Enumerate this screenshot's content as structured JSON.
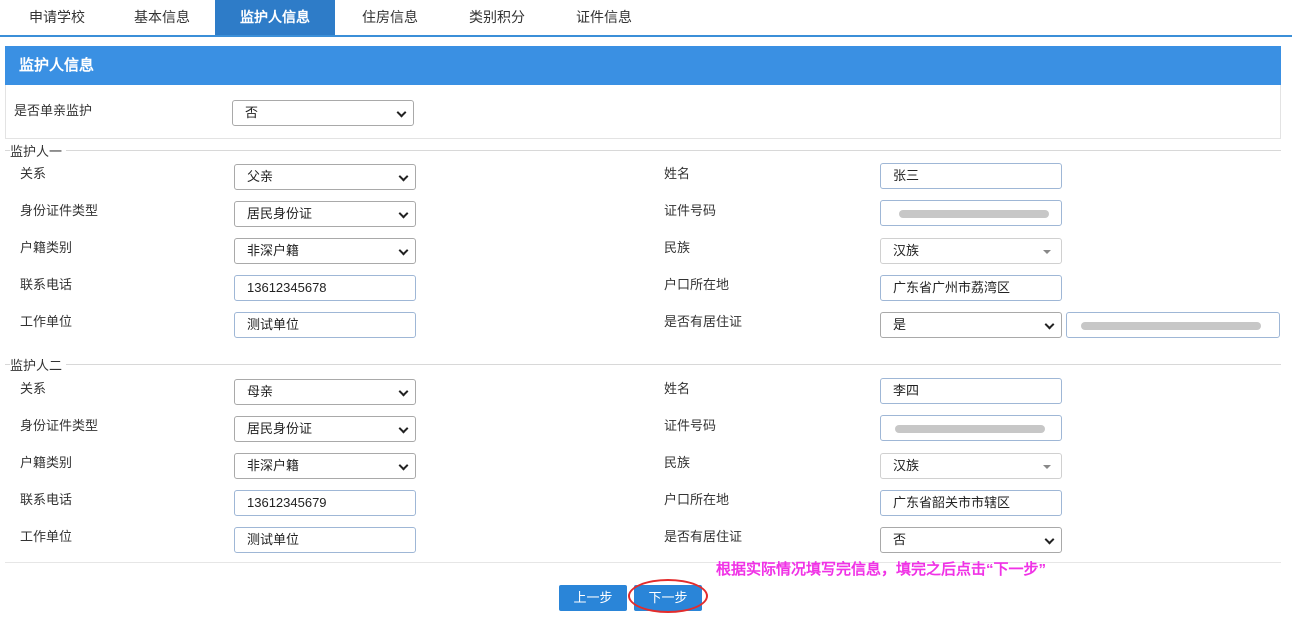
{
  "tabs": [
    {
      "label": "申请学校"
    },
    {
      "label": "基本信息"
    },
    {
      "label": "监护人信息"
    },
    {
      "label": "住房信息"
    },
    {
      "label": "类别积分"
    },
    {
      "label": "证件信息"
    }
  ],
  "active_tab": "监护人信息",
  "panel_title": "监护人信息",
  "single_parent": {
    "label": "是否单亲监护",
    "value": "否"
  },
  "guardian1": {
    "title": "监护人一",
    "relation_label": "关系",
    "relation": "父亲",
    "name_label": "姓名",
    "name": "张三",
    "id_type_label": "身份证件类型",
    "id_type": "居民身份证",
    "id_no_label": "证件号码",
    "hukou_type_label": "户籍类别",
    "hukou_type": "非深户籍",
    "ethnicity_label": "民族",
    "ethnicity": "汉族",
    "phone_label": "联系电话",
    "phone": "13612345678",
    "hukou_place_label": "户口所在地",
    "hukou_place": "广东省广州市荔湾区",
    "employer_label": "工作单位",
    "employer": "测试单位",
    "residence_permit_label": "是否有居住证",
    "residence_permit": "是"
  },
  "guardian2": {
    "title": "监护人二",
    "relation_label": "关系",
    "relation": "母亲",
    "name_label": "姓名",
    "name": "李四",
    "id_type_label": "身份证件类型",
    "id_type": "居民身份证",
    "id_no_label": "证件号码",
    "hukou_type_label": "户籍类别",
    "hukou_type": "非深户籍",
    "ethnicity_label": "民族",
    "ethnicity": "汉族",
    "phone_label": "联系电话",
    "phone": "13612345679",
    "hukou_place_label": "户口所在地",
    "hukou_place": "广东省韶关市市辖区",
    "employer_label": "工作单位",
    "employer": "测试单位",
    "residence_permit_label": "是否有居住证",
    "residence_permit": "否"
  },
  "buttons": {
    "prev": "上一步",
    "next": "下一步"
  },
  "hint": "根据实际情况填写完信息，填完之后点击“下一步”",
  "colors": {
    "accent": "#3a90e3",
    "tab_active": "#2e7cc8",
    "hint": "#f032e6",
    "highlight_circle": "#e32c2c"
  }
}
